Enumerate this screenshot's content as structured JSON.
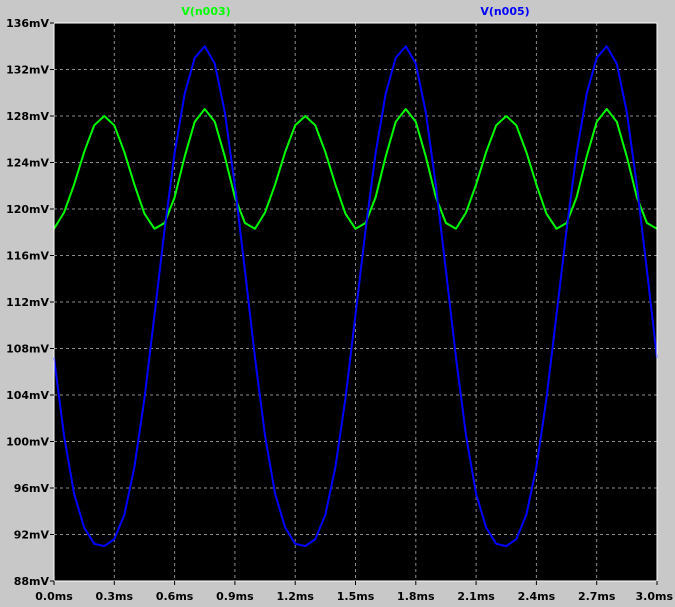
{
  "chart_data": {
    "type": "line",
    "xlabel": "",
    "ylabel": "",
    "x_ticks": [
      "0.0ms",
      "0.3ms",
      "0.6ms",
      "0.9ms",
      "1.2ms",
      "1.5ms",
      "1.8ms",
      "2.1ms",
      "2.4ms",
      "2.7ms",
      "3.0ms"
    ],
    "y_ticks": [
      "88mV",
      "92mV",
      "96mV",
      "100mV",
      "104mV",
      "108mV",
      "112mV",
      "116mV",
      "120mV",
      "124mV",
      "128mV",
      "132mV",
      "136mV"
    ],
    "xlim": [
      0,
      3.0
    ],
    "ylim": [
      88,
      136
    ],
    "x_unit": "ms",
    "y_unit": "mV",
    "grid": true,
    "background_color": "#000000",
    "frame_color": "#c8c8c8",
    "axis_color": "#ffffff",
    "series": [
      {
        "name": "V(n003)",
        "color": "#00ff00",
        "points": [
          [
            0.0,
            118.3
          ],
          [
            0.05,
            119.7
          ],
          [
            0.1,
            122.1
          ],
          [
            0.15,
            124.9
          ],
          [
            0.2,
            127.2
          ],
          [
            0.25,
            128.0
          ],
          [
            0.3,
            127.2
          ],
          [
            0.35,
            124.9
          ],
          [
            0.4,
            122.1
          ],
          [
            0.45,
            119.6
          ],
          [
            0.5,
            118.3
          ],
          [
            0.55,
            118.8
          ],
          [
            0.6,
            121.0
          ],
          [
            0.65,
            124.5
          ],
          [
            0.7,
            127.5
          ],
          [
            0.75,
            128.6
          ],
          [
            0.8,
            127.5
          ],
          [
            0.85,
            124.5
          ],
          [
            0.9,
            121.0
          ],
          [
            0.95,
            118.8
          ],
          [
            1.0,
            118.3
          ],
          [
            1.05,
            119.7
          ],
          [
            1.1,
            122.1
          ],
          [
            1.15,
            124.9
          ],
          [
            1.2,
            127.2
          ],
          [
            1.25,
            128.0
          ],
          [
            1.3,
            127.2
          ],
          [
            1.35,
            124.9
          ],
          [
            1.4,
            122.1
          ],
          [
            1.45,
            119.6
          ],
          [
            1.5,
            118.3
          ],
          [
            1.55,
            118.8
          ],
          [
            1.6,
            121.0
          ],
          [
            1.65,
            124.5
          ],
          [
            1.7,
            127.5
          ],
          [
            1.75,
            128.6
          ],
          [
            1.8,
            127.5
          ],
          [
            1.85,
            124.5
          ],
          [
            1.9,
            121.0
          ],
          [
            1.95,
            118.8
          ],
          [
            2.0,
            118.3
          ],
          [
            2.05,
            119.7
          ],
          [
            2.1,
            122.1
          ],
          [
            2.15,
            124.9
          ],
          [
            2.2,
            127.2
          ],
          [
            2.25,
            128.0
          ],
          [
            2.3,
            127.2
          ],
          [
            2.35,
            124.9
          ],
          [
            2.4,
            122.1
          ],
          [
            2.45,
            119.6
          ],
          [
            2.5,
            118.3
          ],
          [
            2.55,
            118.8
          ],
          [
            2.6,
            121.0
          ],
          [
            2.65,
            124.5
          ],
          [
            2.7,
            127.5
          ],
          [
            2.75,
            128.6
          ],
          [
            2.8,
            127.5
          ],
          [
            2.85,
            124.5
          ],
          [
            2.9,
            121.0
          ],
          [
            2.95,
            118.8
          ],
          [
            3.0,
            118.3
          ]
        ]
      },
      {
        "name": "V(n005)",
        "color": "#0000ff",
        "points": [
          [
            0.0,
            107.2
          ],
          [
            0.05,
            100.5
          ],
          [
            0.1,
            95.5
          ],
          [
            0.15,
            92.6
          ],
          [
            0.2,
            91.2
          ],
          [
            0.25,
            91.0
          ],
          [
            0.3,
            91.6
          ],
          [
            0.35,
            93.7
          ],
          [
            0.4,
            97.8
          ],
          [
            0.45,
            103.7
          ],
          [
            0.5,
            110.9
          ],
          [
            0.55,
            118.2
          ],
          [
            0.6,
            124.8
          ],
          [
            0.65,
            129.9
          ],
          [
            0.7,
            133.0
          ],
          [
            0.75,
            134.0
          ],
          [
            0.8,
            132.5
          ],
          [
            0.85,
            128.3
          ],
          [
            0.9,
            122.0
          ],
          [
            0.95,
            114.7
          ],
          [
            1.0,
            107.2
          ],
          [
            1.05,
            100.5
          ],
          [
            1.1,
            95.5
          ],
          [
            1.15,
            92.6
          ],
          [
            1.2,
            91.2
          ],
          [
            1.25,
            91.0
          ],
          [
            1.3,
            91.6
          ],
          [
            1.35,
            93.7
          ],
          [
            1.4,
            97.8
          ],
          [
            1.45,
            103.7
          ],
          [
            1.5,
            110.9
          ],
          [
            1.55,
            118.2
          ],
          [
            1.6,
            124.8
          ],
          [
            1.65,
            129.9
          ],
          [
            1.7,
            133.0
          ],
          [
            1.75,
            134.0
          ],
          [
            1.8,
            132.5
          ],
          [
            1.85,
            128.3
          ],
          [
            1.9,
            122.0
          ],
          [
            1.95,
            114.7
          ],
          [
            2.0,
            107.2
          ],
          [
            2.05,
            100.5
          ],
          [
            2.1,
            95.5
          ],
          [
            2.15,
            92.6
          ],
          [
            2.2,
            91.2
          ],
          [
            2.25,
            91.0
          ],
          [
            2.3,
            91.6
          ],
          [
            2.35,
            93.7
          ],
          [
            2.4,
            97.8
          ],
          [
            2.45,
            103.7
          ],
          [
            2.5,
            110.9
          ],
          [
            2.55,
            118.2
          ],
          [
            2.6,
            124.8
          ],
          [
            2.65,
            129.9
          ],
          [
            2.7,
            133.0
          ],
          [
            2.75,
            134.0
          ],
          [
            2.8,
            132.5
          ],
          [
            2.85,
            128.3
          ],
          [
            2.9,
            122.0
          ],
          [
            2.95,
            114.7
          ],
          [
            3.0,
            107.2
          ]
        ]
      }
    ]
  }
}
